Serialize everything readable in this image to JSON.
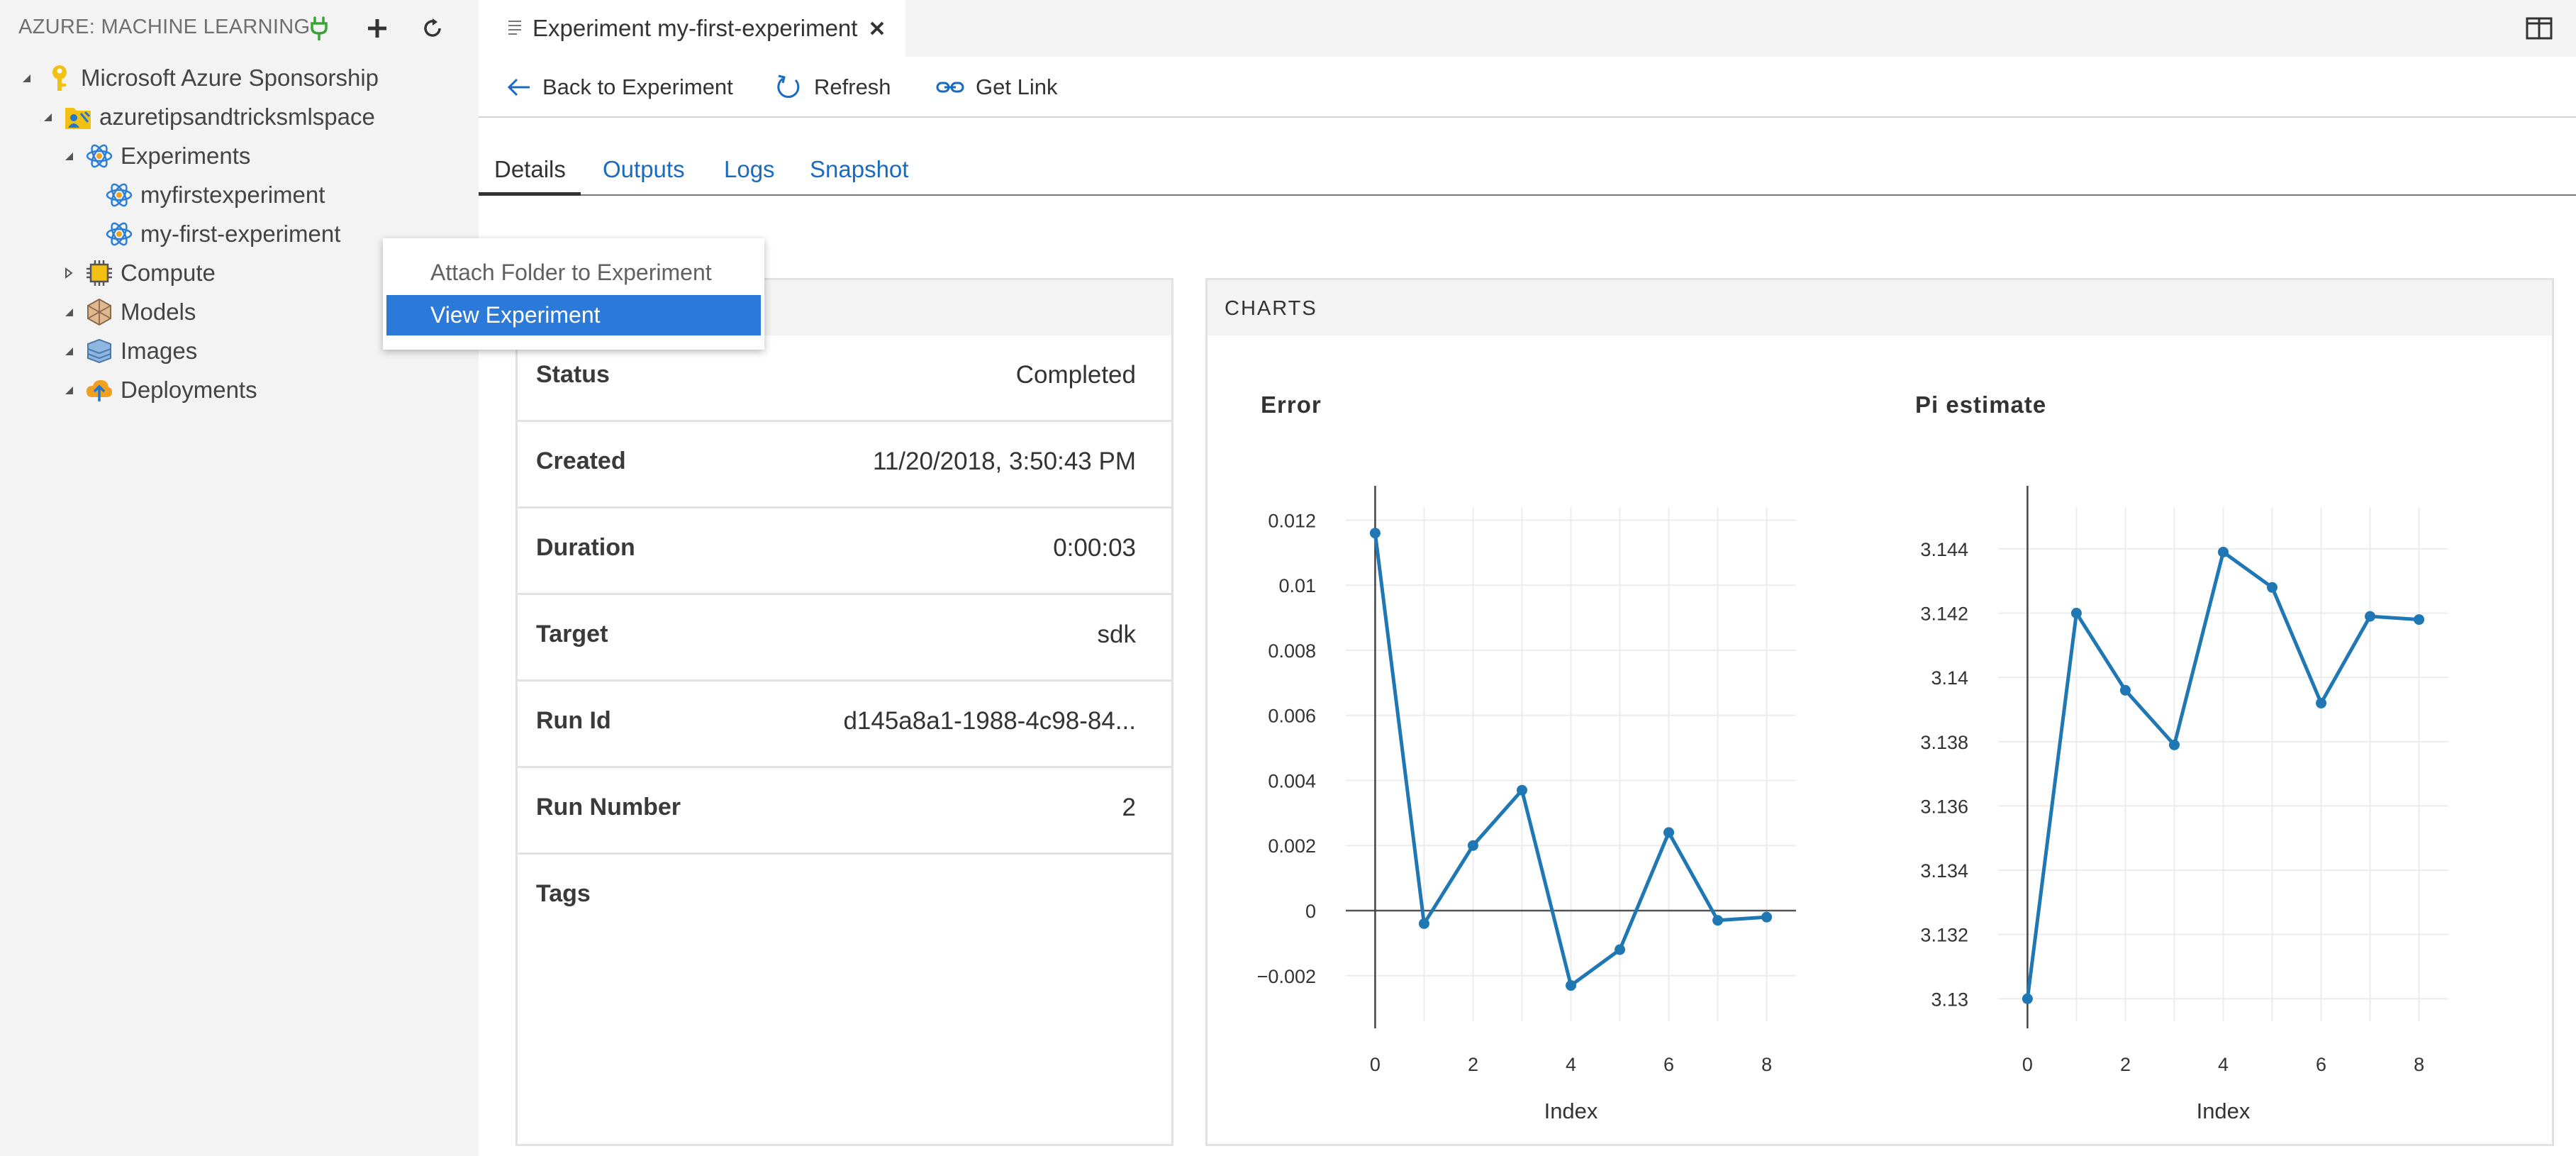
{
  "sidebar": {
    "title": "AZURE: MACHINE LEARNING",
    "tree": [
      {
        "label": "Microsoft Azure Sponsorship",
        "icon": "key-icon",
        "level": 0
      },
      {
        "label": "azuretipsandtricksmlspace",
        "icon": "workspace-icon",
        "level": 1
      },
      {
        "label": "Experiments",
        "icon": "experiment-icon",
        "level": 2
      },
      {
        "label": "myfirstexperiment",
        "icon": "experiment-icon",
        "level": 3
      },
      {
        "label": "my-first-experiment",
        "icon": "experiment-icon",
        "level": 3
      },
      {
        "label": "Compute",
        "icon": "compute-icon",
        "level": 2
      },
      {
        "label": "Models",
        "icon": "models-icon",
        "level": 2
      },
      {
        "label": "Images",
        "icon": "images-icon",
        "level": 2
      },
      {
        "label": "Deployments",
        "icon": "deployments-icon",
        "level": 2
      }
    ]
  },
  "context_menu": {
    "items": [
      {
        "label": "Attach Folder to Experiment"
      },
      {
        "label": "View Experiment"
      }
    ]
  },
  "editor": {
    "tab_title": "Experiment my-first-experiment",
    "toolbar": {
      "back": "Back to Experiment",
      "refresh": "Refresh",
      "get_link": "Get Link"
    },
    "tabs": [
      "Details",
      "Outputs",
      "Logs",
      "Snapshot"
    ],
    "details": [
      {
        "label": "Status",
        "value": "Completed"
      },
      {
        "label": "Created",
        "value": "11/20/2018, 3:50:43 PM"
      },
      {
        "label": "Duration",
        "value": "0:00:03"
      },
      {
        "label": "Target",
        "value": "sdk"
      },
      {
        "label": "Run Id",
        "value": "d145a8a1-1988-4c98-84..."
      },
      {
        "label": "Run Number",
        "value": "2"
      },
      {
        "label": "Tags",
        "value": ""
      }
    ],
    "charts_title": "CHARTS"
  },
  "colors": {
    "accent": "#2b79d8",
    "line": "#1f77b4",
    "link": "#1a6bbf",
    "sidebar_bg": "#f3f3f3"
  },
  "chart_data": [
    {
      "type": "line",
      "title": "Error",
      "xlabel": "Index",
      "ylabel": "",
      "x": [
        0,
        1,
        2,
        3,
        4,
        5,
        6,
        7,
        8
      ],
      "values": [
        0.0116,
        -0.0004,
        0.002,
        0.0037,
        -0.0023,
        -0.0012,
        0.0024,
        -0.0003,
        -0.0002
      ],
      "ylim": [
        -0.0034,
        0.0124
      ],
      "xlim": [
        -0.6,
        8.6
      ],
      "xticks": [
        0,
        2,
        4,
        6,
        8
      ],
      "yticks": [
        -0.002,
        0,
        0.002,
        0.004,
        0.006,
        0.008,
        0.01,
        0.012
      ],
      "ytick_labels": [
        "−0.002",
        "0",
        "0.002",
        "0.004",
        "0.006",
        "0.008",
        "0.01",
        "0.012"
      ],
      "grid": true
    },
    {
      "type": "line",
      "title": "Pi estimate",
      "xlabel": "Index",
      "ylabel": "",
      "x": [
        0,
        1,
        2,
        3,
        4,
        5,
        6,
        7,
        8
      ],
      "values": [
        3.13,
        3.142,
        3.1396,
        3.1379,
        3.1439,
        3.1428,
        3.1392,
        3.1419,
        3.1418
      ],
      "ylim": [
        3.1293,
        3.1453
      ],
      "xlim": [
        -0.6,
        8.6
      ],
      "xticks": [
        0,
        2,
        4,
        6,
        8
      ],
      "yticks": [
        3.13,
        3.132,
        3.134,
        3.136,
        3.138,
        3.14,
        3.142,
        3.144
      ],
      "ytick_labels": [
        "3.13",
        "3.132",
        "3.134",
        "3.136",
        "3.138",
        "3.14",
        "3.142",
        "3.144"
      ],
      "grid": true
    }
  ]
}
